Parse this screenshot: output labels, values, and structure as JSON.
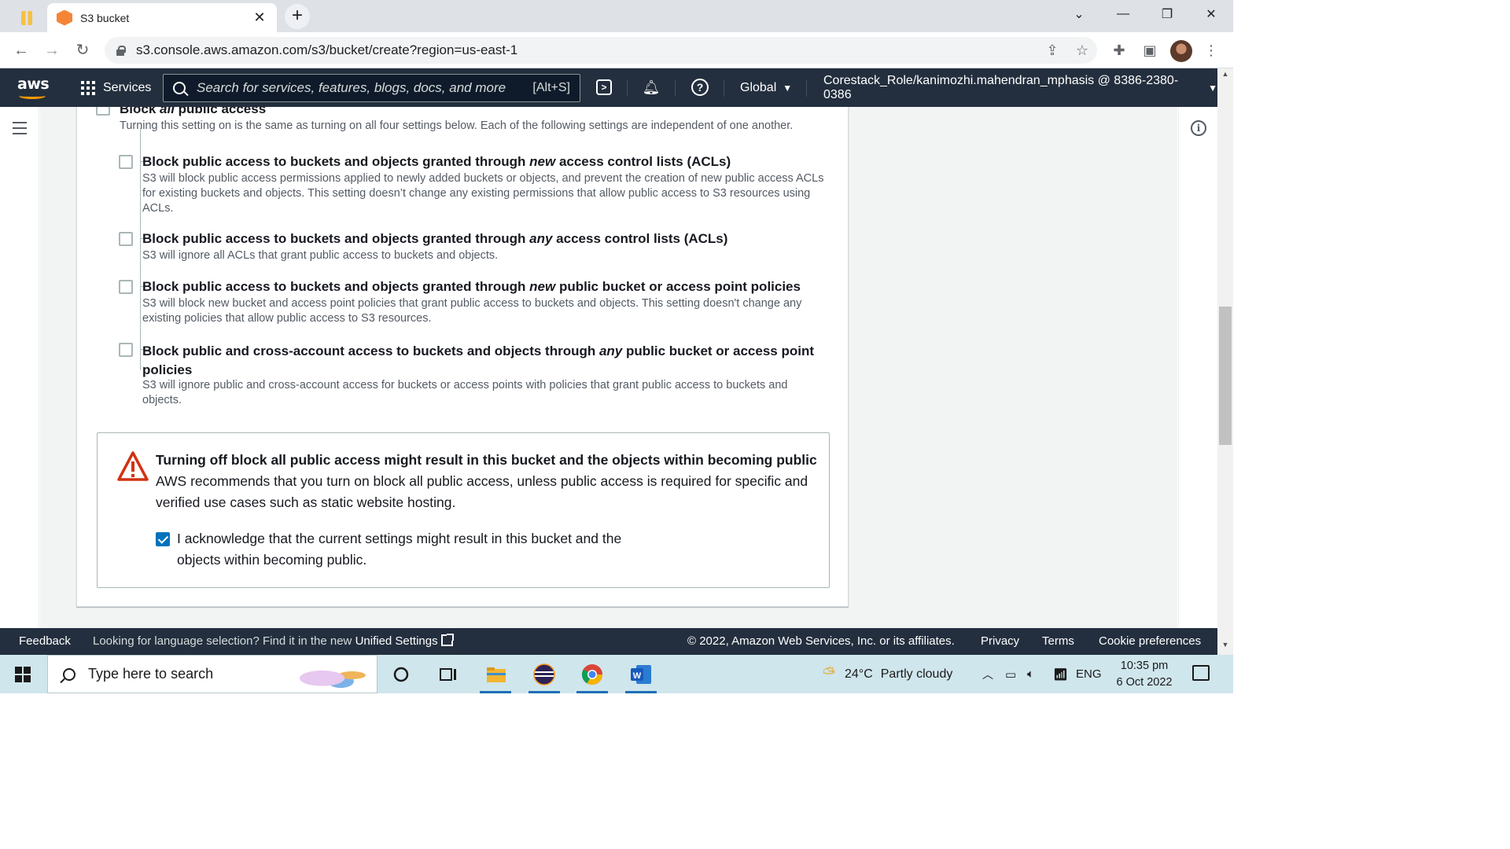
{
  "browser": {
    "tab_title": "S3 bucket",
    "tab_close": "✕",
    "new_tab": "+",
    "url": "s3.console.aws.amazon.com/s3/bucket/create?region=us-east-1"
  },
  "aws_nav": {
    "logo": "aws",
    "services_label": "Services",
    "search_placeholder": "Search for services, features, blogs, docs, and more",
    "search_shortcut": "[Alt+S]",
    "region": "Global",
    "account": "Corestack_Role/kanimozhi.mahendran_mphasis @ 8386-2380-0386"
  },
  "block_public_access": {
    "master_title_prefix": "Block ",
    "master_title_em": "all",
    "master_title_suffix": " public access",
    "master_desc": "Turning this setting on is the same as turning on all four settings below. Each of the following settings are independent of one another.",
    "options": [
      {
        "title_prefix": "Block public access to buckets and objects granted through ",
        "title_em": "new",
        "title_suffix": " access control lists (ACLs)",
        "desc": "S3 will block public access permissions applied to newly added buckets or objects, and prevent the creation of new public access ACLs for existing buckets and objects. This setting doesn’t change any existing permissions that allow public access to S3 resources using ACLs.",
        "checked": false
      },
      {
        "title_prefix": "Block public access to buckets and objects granted through ",
        "title_em": "any",
        "title_suffix": " access control lists (ACLs)",
        "desc": "S3 will ignore all ACLs that grant public access to buckets and objects.",
        "checked": false
      },
      {
        "title_prefix": "Block public access to buckets and objects granted through ",
        "title_em": "new",
        "title_suffix": " public bucket or access point policies",
        "desc": "S3 will block new bucket and access point policies that grant public access to buckets and objects. This setting doesn't change any existing policies that allow public access to S3 resources.",
        "checked": false
      },
      {
        "title_prefix": "Block public and cross-account access to buckets and objects through ",
        "title_em": "any",
        "title_suffix": " public bucket or access point policies",
        "desc": "S3 will ignore public and cross-account access for buckets or access points with policies that grant public access to buckets and objects.",
        "checked": false
      }
    ]
  },
  "warning": {
    "title": "Turning off block all public access might result in this bucket and the objects within becoming public",
    "text": "AWS recommends that you turn on block all public access, unless public access is required for specific and verified use cases such as static website hosting.",
    "ack_label": "I acknowledge that the current settings might result in this bucket and the objects within becoming public.",
    "ack_checked": true
  },
  "footer": {
    "feedback": "Feedback",
    "lang_prompt": "Looking for language selection? Find it in the new",
    "unified_settings": "Unified Settings",
    "copyright": "© 2022, Amazon Web Services, Inc. or its affiliates.",
    "privacy": "Privacy",
    "terms": "Terms",
    "cookie": "Cookie preferences"
  },
  "taskbar": {
    "search_placeholder": "Type here to search",
    "weather_temp": "24°C",
    "weather_desc": "Partly cloudy",
    "language": "ENG",
    "time": "10:35 pm",
    "date": "6 Oct 2022"
  },
  "colors": {
    "aws_nav_bg": "#232f3e",
    "aws_orange": "#ff9900",
    "checkbox_blue": "#0073bb",
    "warning_red": "#d13212"
  }
}
